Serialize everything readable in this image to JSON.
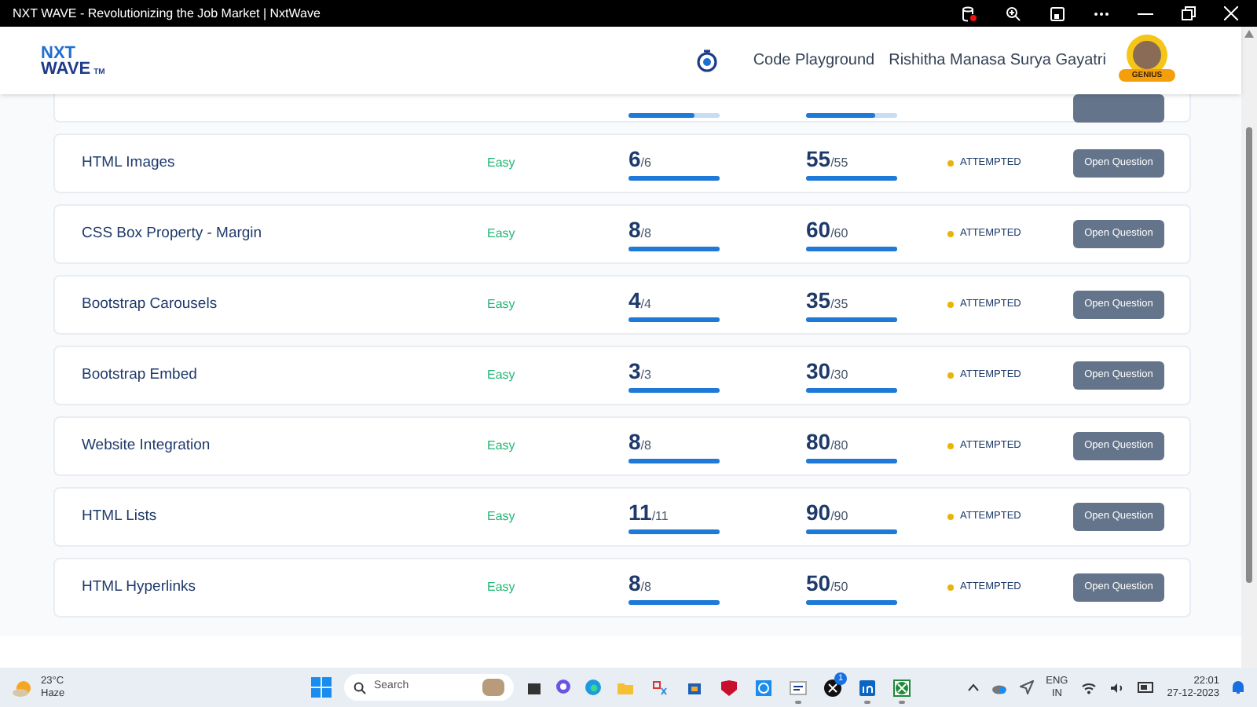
{
  "window": {
    "title": "NXT WAVE - Revolutionizing the Job Market | NxtWave"
  },
  "header": {
    "logo": [
      "NXT",
      "WAVE"
    ],
    "logo_mark": "TM",
    "nav_link": "Code Playground",
    "user_name": "Rishitha Manasa Surya Gayatri",
    "badge": "GENIUS"
  },
  "partial_row": {
    "score": {
      "level": 0.72
    },
    "points": {
      "level": 0.75
    }
  },
  "rows": [
    {
      "name": "HTML Images",
      "difficulty": "Easy",
      "score": {
        "value": "6",
        "total": "/6",
        "level": 1
      },
      "points": {
        "value": "55",
        "total": "/55",
        "level": 1
      },
      "status": "ATTEMPTED",
      "button": "Open Question"
    },
    {
      "name": "CSS Box Property - Margin",
      "difficulty": "Easy",
      "score": {
        "value": "8",
        "total": "/8",
        "level": 1
      },
      "points": {
        "value": "60",
        "total": "/60",
        "level": 1
      },
      "status": "ATTEMPTED",
      "button": "Open Question"
    },
    {
      "name": "Bootstrap Carousels",
      "difficulty": "Easy",
      "score": {
        "value": "4",
        "total": "/4",
        "level": 1
      },
      "points": {
        "value": "35",
        "total": "/35",
        "level": 1
      },
      "status": "ATTEMPTED",
      "button": "Open Question"
    },
    {
      "name": "Bootstrap Embed",
      "difficulty": "Easy",
      "score": {
        "value": "3",
        "total": "/3",
        "level": 1
      },
      "points": {
        "value": "30",
        "total": "/30",
        "level": 1
      },
      "status": "ATTEMPTED",
      "button": "Open Question"
    },
    {
      "name": "Website Integration",
      "difficulty": "Easy",
      "score": {
        "value": "8",
        "total": "/8",
        "level": 1
      },
      "points": {
        "value": "80",
        "total": "/80",
        "level": 1
      },
      "status": "ATTEMPTED",
      "button": "Open Question"
    },
    {
      "name": "HTML Lists",
      "difficulty": "Easy",
      "score": {
        "value": "11",
        "total": "/11",
        "level": 1
      },
      "points": {
        "value": "90",
        "total": "/90",
        "level": 1
      },
      "status": "ATTEMPTED",
      "button": "Open Question"
    },
    {
      "name": "HTML Hyperlinks",
      "difficulty": "Easy",
      "score": {
        "value": "8",
        "total": "/8",
        "level": 1
      },
      "points": {
        "value": "50",
        "total": "/50",
        "level": 1
      },
      "status": "ATTEMPTED",
      "button": "Open Question"
    }
  ],
  "taskbar": {
    "weather": {
      "temperature": "23°C",
      "condition": "Haze"
    },
    "search": {
      "placeholder": "Search"
    },
    "apps": [
      {
        "kind": "folder",
        "running": false
      },
      {
        "kind": "snip",
        "running": false
      },
      {
        "kind": "store",
        "running": false
      },
      {
        "kind": "shield",
        "running": false
      },
      {
        "kind": "circle",
        "running": false
      },
      {
        "kind": "notes",
        "running": true
      },
      {
        "kind": "x",
        "running": false,
        "badge": "1"
      },
      {
        "kind": "in",
        "running": true
      },
      {
        "kind": "xbox",
        "running": true
      }
    ],
    "language": [
      "ENG",
      "IN"
    ],
    "time": "22:01",
    "date": "27-12-2023"
  }
}
